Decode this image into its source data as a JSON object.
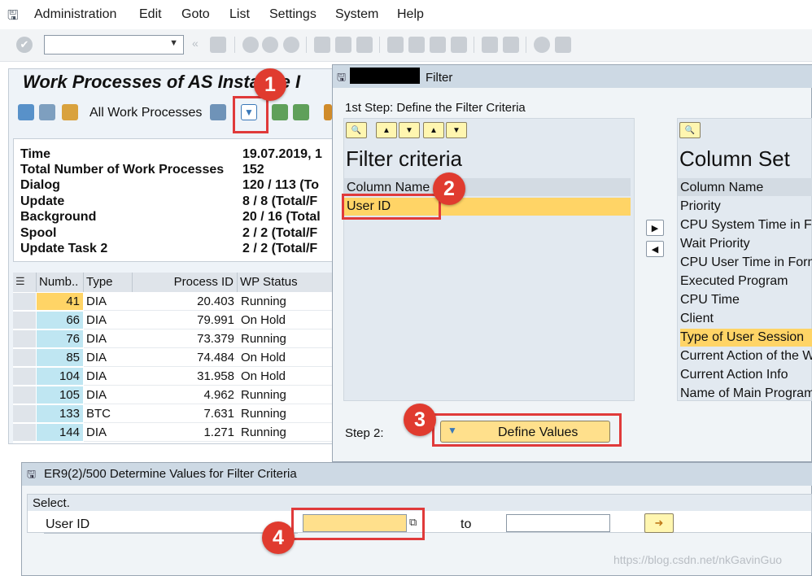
{
  "menubar": {
    "items": [
      "Administration",
      "Edit",
      "Goto",
      "List",
      "Settings",
      "System",
      "Help"
    ]
  },
  "toolbar": {
    "command_value": ""
  },
  "background_window": {
    "title": "Work Processes of AS Instance I",
    "app_toolbar": {
      "all_wp_label": "All Work Processes"
    },
    "info": {
      "labels": [
        "Time",
        "Total Number of Work Processes",
        "Dialog",
        "Update",
        "Background",
        "Spool",
        "Update Task 2"
      ],
      "values": [
        "19.07.2019, 1",
        "152",
        "120 / 113 (To",
        "8 / 8 (Total/F",
        "20 / 16 (Total",
        "2 / 2 (Total/F",
        "2 / 2 (Total/F"
      ]
    },
    "grid": {
      "headers": [
        "Numb..",
        "Type",
        "Process ID",
        "WP Status"
      ],
      "rows": [
        {
          "num": "41",
          "type": "DIA",
          "pid": "20.403",
          "status": "Running"
        },
        {
          "num": "66",
          "type": "DIA",
          "pid": "79.991",
          "status": "On Hold"
        },
        {
          "num": "76",
          "type": "DIA",
          "pid": "73.379",
          "status": "Running"
        },
        {
          "num": "85",
          "type": "DIA",
          "pid": "74.484",
          "status": "On Hold"
        },
        {
          "num": "104",
          "type": "DIA",
          "pid": "31.958",
          "status": "On Hold"
        },
        {
          "num": "105",
          "type": "DIA",
          "pid": "4.962",
          "status": "Running"
        },
        {
          "num": "133",
          "type": "BTC",
          "pid": "7.631",
          "status": "Running"
        },
        {
          "num": "144",
          "type": "DIA",
          "pid": "1.271",
          "status": "Running"
        }
      ]
    }
  },
  "filter_dialog": {
    "title": "Filter",
    "step1_label": "1st Step: Define the Filter Criteria",
    "filter_criteria": {
      "heading": "Filter criteria",
      "column_header": "Column Name",
      "items": [
        "User ID"
      ]
    },
    "column_set": {
      "heading": "Column Set",
      "column_header": "Column Name",
      "items": [
        "Priority",
        "CPU System Time in Fo",
        "Wait Priority",
        "CPU User Time in Form",
        "Executed Program",
        "CPU Time",
        "Client",
        "Type of User Session",
        "Current Action of the W",
        "Current Action Info",
        "Name of Main Program"
      ]
    },
    "step2_label": "Step 2:",
    "define_values_label": "Define Values"
  },
  "values_dialog": {
    "title": "ER9(2)/500 Determine Values for Filter Criteria",
    "section_label": "Select.",
    "field_label": "User ID",
    "from_value": "",
    "to_label": "to",
    "to_value": ""
  },
  "callouts": [
    "1",
    "2",
    "3",
    "4"
  ],
  "watermark": "https://blog.csdn.net/nkGavinGuo",
  "colors": {
    "highlight_yellow": "#ffe08c",
    "selected_row": "#ffd466",
    "number_column": "#bfe6f2",
    "callout_red": "#e03b2f"
  }
}
